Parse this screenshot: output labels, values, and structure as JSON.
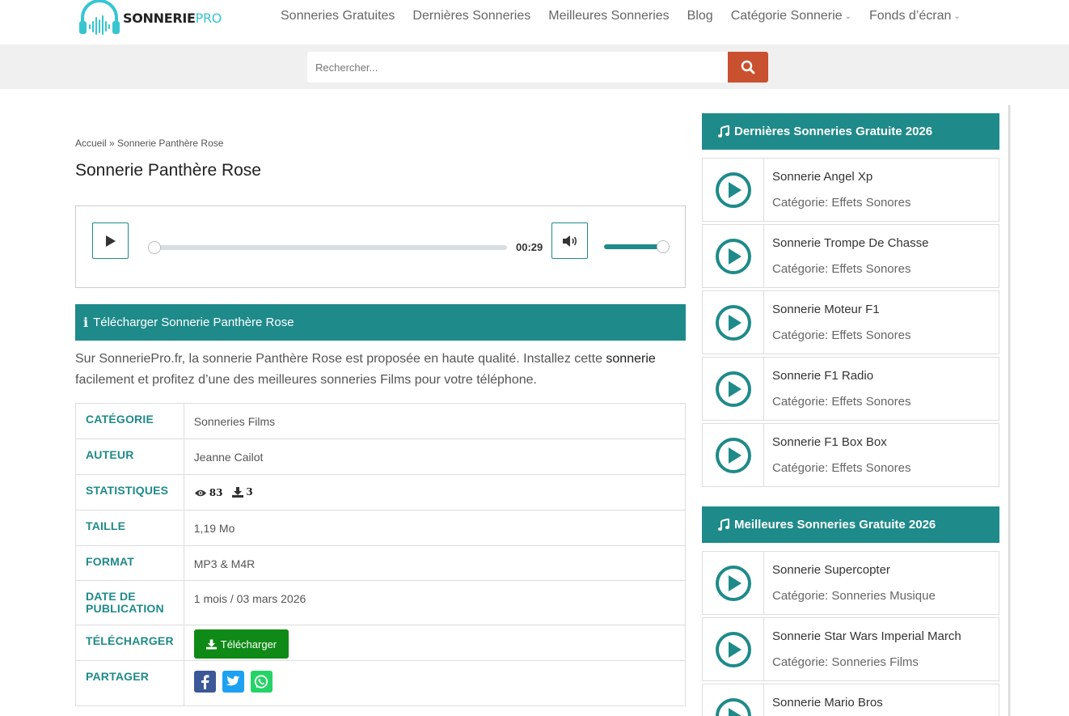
{
  "header": {
    "logo_main": "SONNERIE",
    "logo_accent": "PRO",
    "nav": [
      {
        "label": "Sonneries Gratuites",
        "dropdown": false
      },
      {
        "label": "Dernières Sonneries",
        "dropdown": false
      },
      {
        "label": "Meilleures Sonneries",
        "dropdown": false
      },
      {
        "label": "Blog",
        "dropdown": false
      },
      {
        "label": "Catégorie Sonnerie",
        "dropdown": true
      },
      {
        "label": "Fonds d’écran",
        "dropdown": true
      }
    ]
  },
  "search": {
    "placeholder": "Rechercher..."
  },
  "breadcrumb": "Accueil » Sonnerie Panthère Rose",
  "page_title": "Sonnerie Panthère Rose",
  "player": {
    "time": "00:29",
    "progress": 0,
    "volume": 1
  },
  "download_section": {
    "title": "Télécharger Sonnerie Panthère Rose",
    "desc_before": "Sur SonneriePro.fr, la sonnerie Panthère Rose est proposée en haute qualité. Installez cette ",
    "desc_strong": "sonnerie",
    "desc_after": " facilement et profitez d’une des meilleures sonneries Films pour votre téléphone."
  },
  "info": {
    "category_label": "CATÉGORIE",
    "category_value": "Sonneries Films",
    "author_label": "AUTEUR",
    "author_value": "Jeanne Cailot",
    "stats_label": "STATISTIQUES",
    "views": "83",
    "downloads": "3",
    "size_label": "TAILLE",
    "size_value": "1,19 Mo",
    "format_label": "FORMAT",
    "format_value": "MP3 & M4R",
    "date_label": "DATE DE PUBLICATION",
    "date_value": "1 mois / 03 mars 2026",
    "download_label": "TÉLÉCHARGER",
    "download_button": "Télécharger",
    "share_label": "PARTAGER"
  },
  "sidebar": {
    "latest_title": "Dernières Sonneries Gratuite 2026",
    "latest": [
      {
        "title": "Sonnerie Angel Xp",
        "category": "Catégorie: Effets Sonores"
      },
      {
        "title": "Sonnerie Trompe De Chasse",
        "category": "Catégorie: Effets Sonores"
      },
      {
        "title": "Sonnerie Moteur F1",
        "category": "Catégorie: Effets Sonores"
      },
      {
        "title": "Sonnerie F1 Radio",
        "category": "Catégorie: Effets Sonores"
      },
      {
        "title": "Sonnerie F1 Box Box",
        "category": "Catégorie: Effets Sonores"
      }
    ],
    "best_title": "Meilleures Sonneries Gratuite 2026",
    "best": [
      {
        "title": "Sonnerie Supercopter",
        "category": "Catégorie: Sonneries Musique"
      },
      {
        "title": "Sonnerie Star Wars Imperial March",
        "category": "Catégorie: Sonneries Films"
      },
      {
        "title": "Sonnerie Mario Bros",
        "category": ""
      }
    ]
  },
  "colors": {
    "teal": "#1f8a8a",
    "search_button": "#c9512f",
    "download_green": "#0f8a16",
    "logo_accent": "#36c5d1"
  }
}
